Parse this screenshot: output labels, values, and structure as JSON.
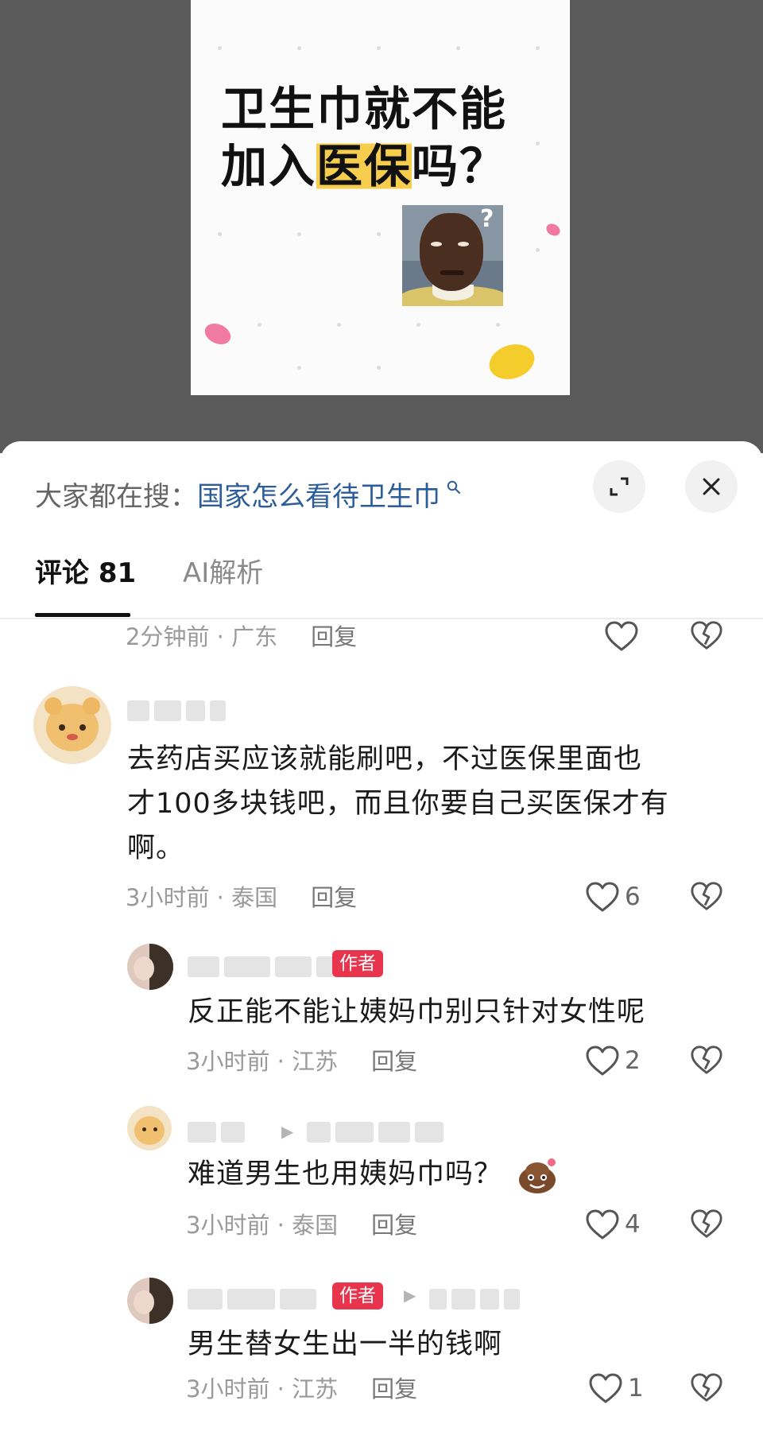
{
  "post": {
    "title_line1": "卫生巾就不能",
    "title_line2_pre": "加入",
    "title_line2_highlight": "医保",
    "title_line2_post": "吗？",
    "meme_mark": "?"
  },
  "search": {
    "prefix": "大家都在搜：",
    "query": "国家怎么看待卫生巾",
    "icon": "search-icon"
  },
  "tabs": [
    {
      "label": "评论",
      "count": "81"
    },
    {
      "label": "AI解析"
    }
  ],
  "comments": {
    "c0": {
      "time": "2分钟前",
      "location": "广东",
      "reply": "回复"
    },
    "c1": {
      "line1": "去药店买应该就能刷吧，不过医保里面也",
      "line2": "才100多块钱吧，而且你要自己买医保才有",
      "line3": "啊。",
      "time": "3小时前",
      "location": "泰国",
      "reply": "回复",
      "likes": "6"
    },
    "c2": {
      "badge": "作者",
      "text": "反正能不能让姨妈巾别只针对女性呢",
      "time": "3小时前",
      "location": "江苏",
      "reply": "回复",
      "likes": "2"
    },
    "c3": {
      "text": "难道男生也用姨妈巾吗？",
      "time": "3小时前",
      "location": "泰国",
      "reply": "回复",
      "likes": "4"
    },
    "c4": {
      "badge": "作者",
      "text": "男生替女生出一半的钱啊",
      "time": "3小时前",
      "location": "江苏",
      "reply": "回复",
      "likes": "1"
    }
  },
  "colors": {
    "accent_link": "#2d5d99",
    "author_badge": "#e8344c",
    "highlight": "#f6cd4c",
    "top_background": "#5a5a5a"
  }
}
